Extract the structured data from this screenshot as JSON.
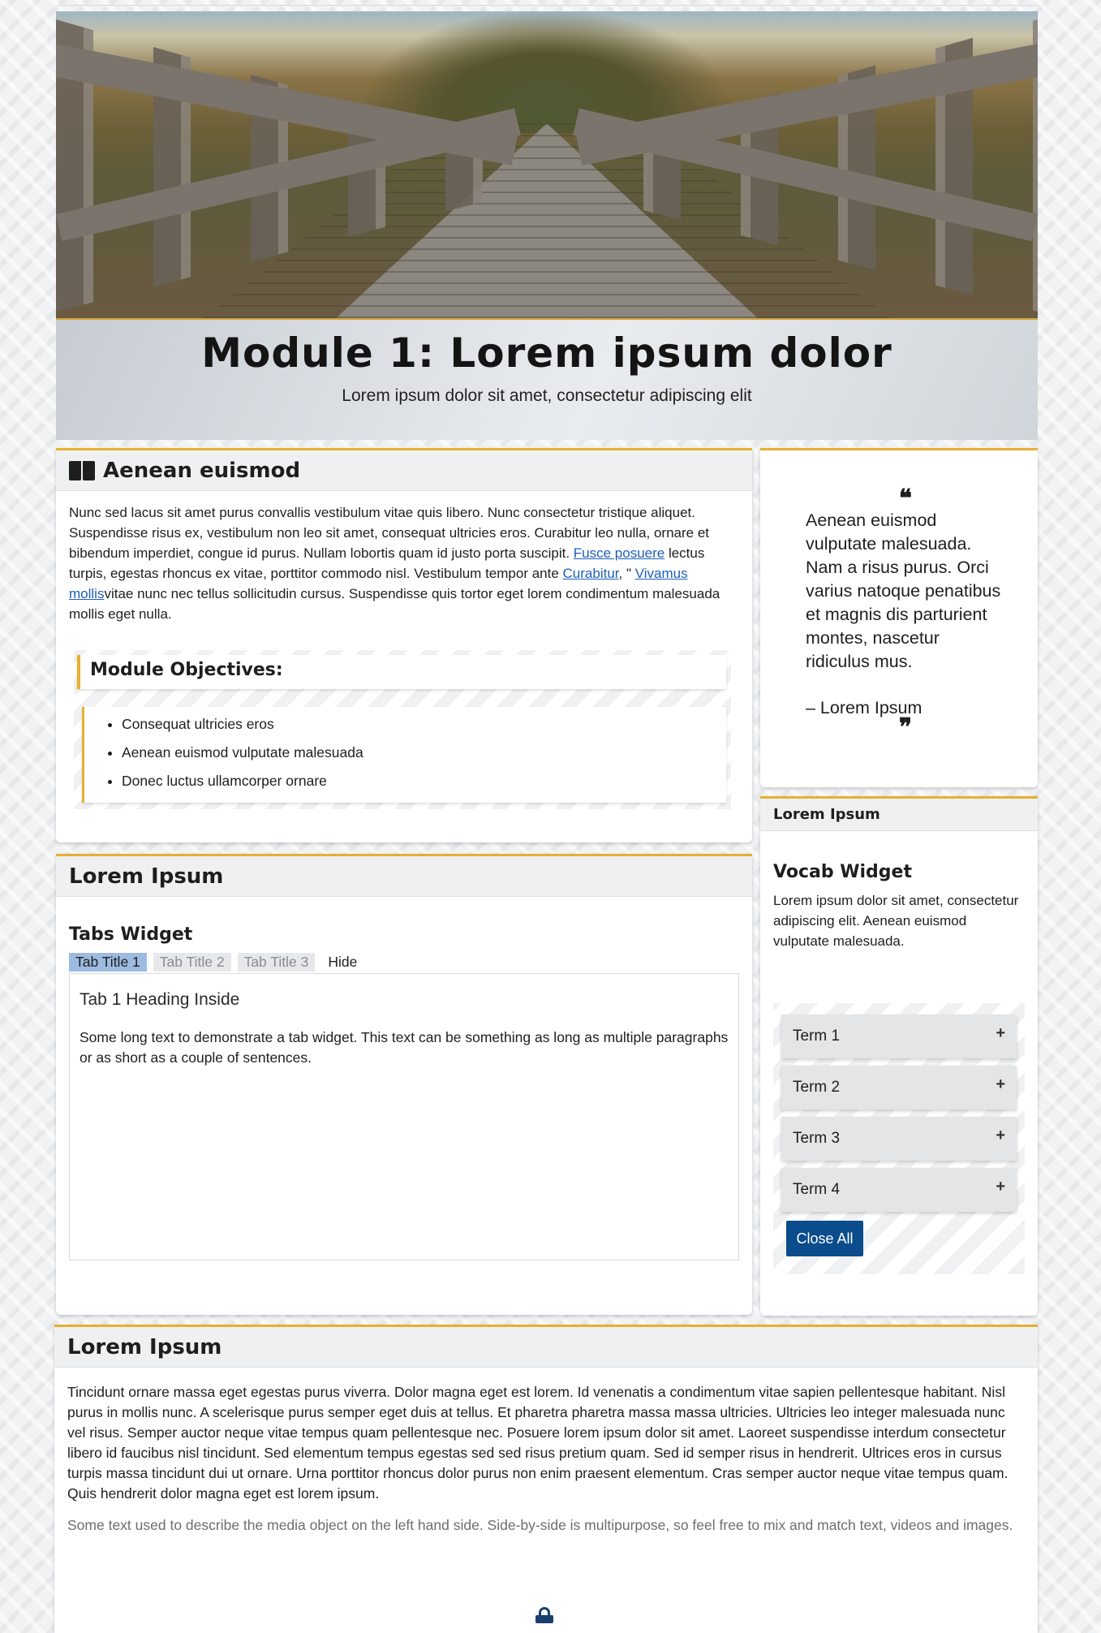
{
  "header": {
    "title": "Module 1: Lorem ipsum dolor",
    "subtitle": "Lorem ipsum dolor sit amet, consectetur adipiscing elit"
  },
  "intro": {
    "heading": "Aenean euismod",
    "icon": "book-open-icon",
    "text_1": "Nunc sed lacus sit amet purus convallis vestibulum vitae quis libero. Nunc consectetur tristique aliquet. Suspendisse risus ex, vestibulum non leo sit amet, consequat ultricies eros. Curabitur leo nulla, ornare et bibendum imperdiet, congue id purus. Nullam lobortis quam id justo porta suscipit. ",
    "link_1": "Fusce posuere",
    "text_2": " lectus turpis, egestas rhoncus ex vitae, porttitor commodo nisl. Vestibulum tempor ante ",
    "link_2": "Curabitur",
    "text_3": ", \" ",
    "link_3": "Vivamus mollis",
    "text_4": "vitae nunc nec tellus sollicitudin cursus. Suspendisse quis tortor eget lorem condimentum malesuada mollis eget nulla.",
    "objectives_title": "Module Objectives:",
    "objectives": [
      "Consequat ultricies eros",
      "Aenean euismod vulputate malesuada",
      "Donec luctus ullamcorper ornare"
    ]
  },
  "quote": {
    "open_mark": "❝",
    "text": "Aenean euismod vulputate malesuada. Nam a risus purus. Orci varius natoque penatibus et magnis dis parturient montes, nascetur ridiculus mus.",
    "author": "– Lorem Ipsum",
    "close_mark": "❞"
  },
  "vocab": {
    "header": "Lorem Ipsum",
    "title": "Vocab Widget",
    "description": "Lorem ipsum dolor sit amet, consectetur adipiscing elit. Aenean euismod vulputate malesuada.",
    "terms": [
      "Term 1",
      "Term 2",
      "Term 3",
      "Term 4"
    ],
    "expand_symbol": "+",
    "close_all": "Close All"
  },
  "tabs_card": {
    "header": "Lorem Ipsum",
    "title": "Tabs Widget",
    "tabs": [
      "Tab Title 1",
      "Tab Title 2",
      "Tab Title 3"
    ],
    "hide": "Hide",
    "panel_heading": "Tab 1 Heading Inside",
    "panel_text": "Some long text to demonstrate a tab widget. This text can be something as long as multiple paragraphs or as short as a couple of sentences."
  },
  "bottom_card": {
    "header": "Lorem Ipsum",
    "text": "Tincidunt ornare massa eget egestas purus viverra. Dolor magna eget est lorem. Id venenatis a condimentum vitae sapien pellentesque habitant. Nisl purus in mollis nunc. A scelerisque purus semper eget duis at tellus. Et pharetra pharetra massa massa ultricies. Ultricies leo integer malesuada nunc vel risus. Semper auctor neque vitae tempus quam pellentesque nec. Posuere lorem ipsum dolor sit amet. Laoreet suspendisse interdum consectetur libero id faucibus nisl tincidunt. Sed elementum tempus egestas sed sed risus pretium quam. Sed id semper risus in hendrerit. Ultrices eros in cursus turpis massa tincidunt dui ut ornare. Urna porttitor rhoncus dolor purus non enim praesent elementum. Cras semper auctor neque vitae tempus quam. Quis hendrerit dolor magna eget est lorem ipsum.",
    "caption": "Some text used to describe the media object on the left hand side. Side-by-side is multipurpose, so feel free to mix and match text, videos and images."
  },
  "colors": {
    "accent": "#e6b12f",
    "link": "#1d5fb8",
    "button": "#0a4c8c",
    "active_tab": "#9dbbe0"
  }
}
